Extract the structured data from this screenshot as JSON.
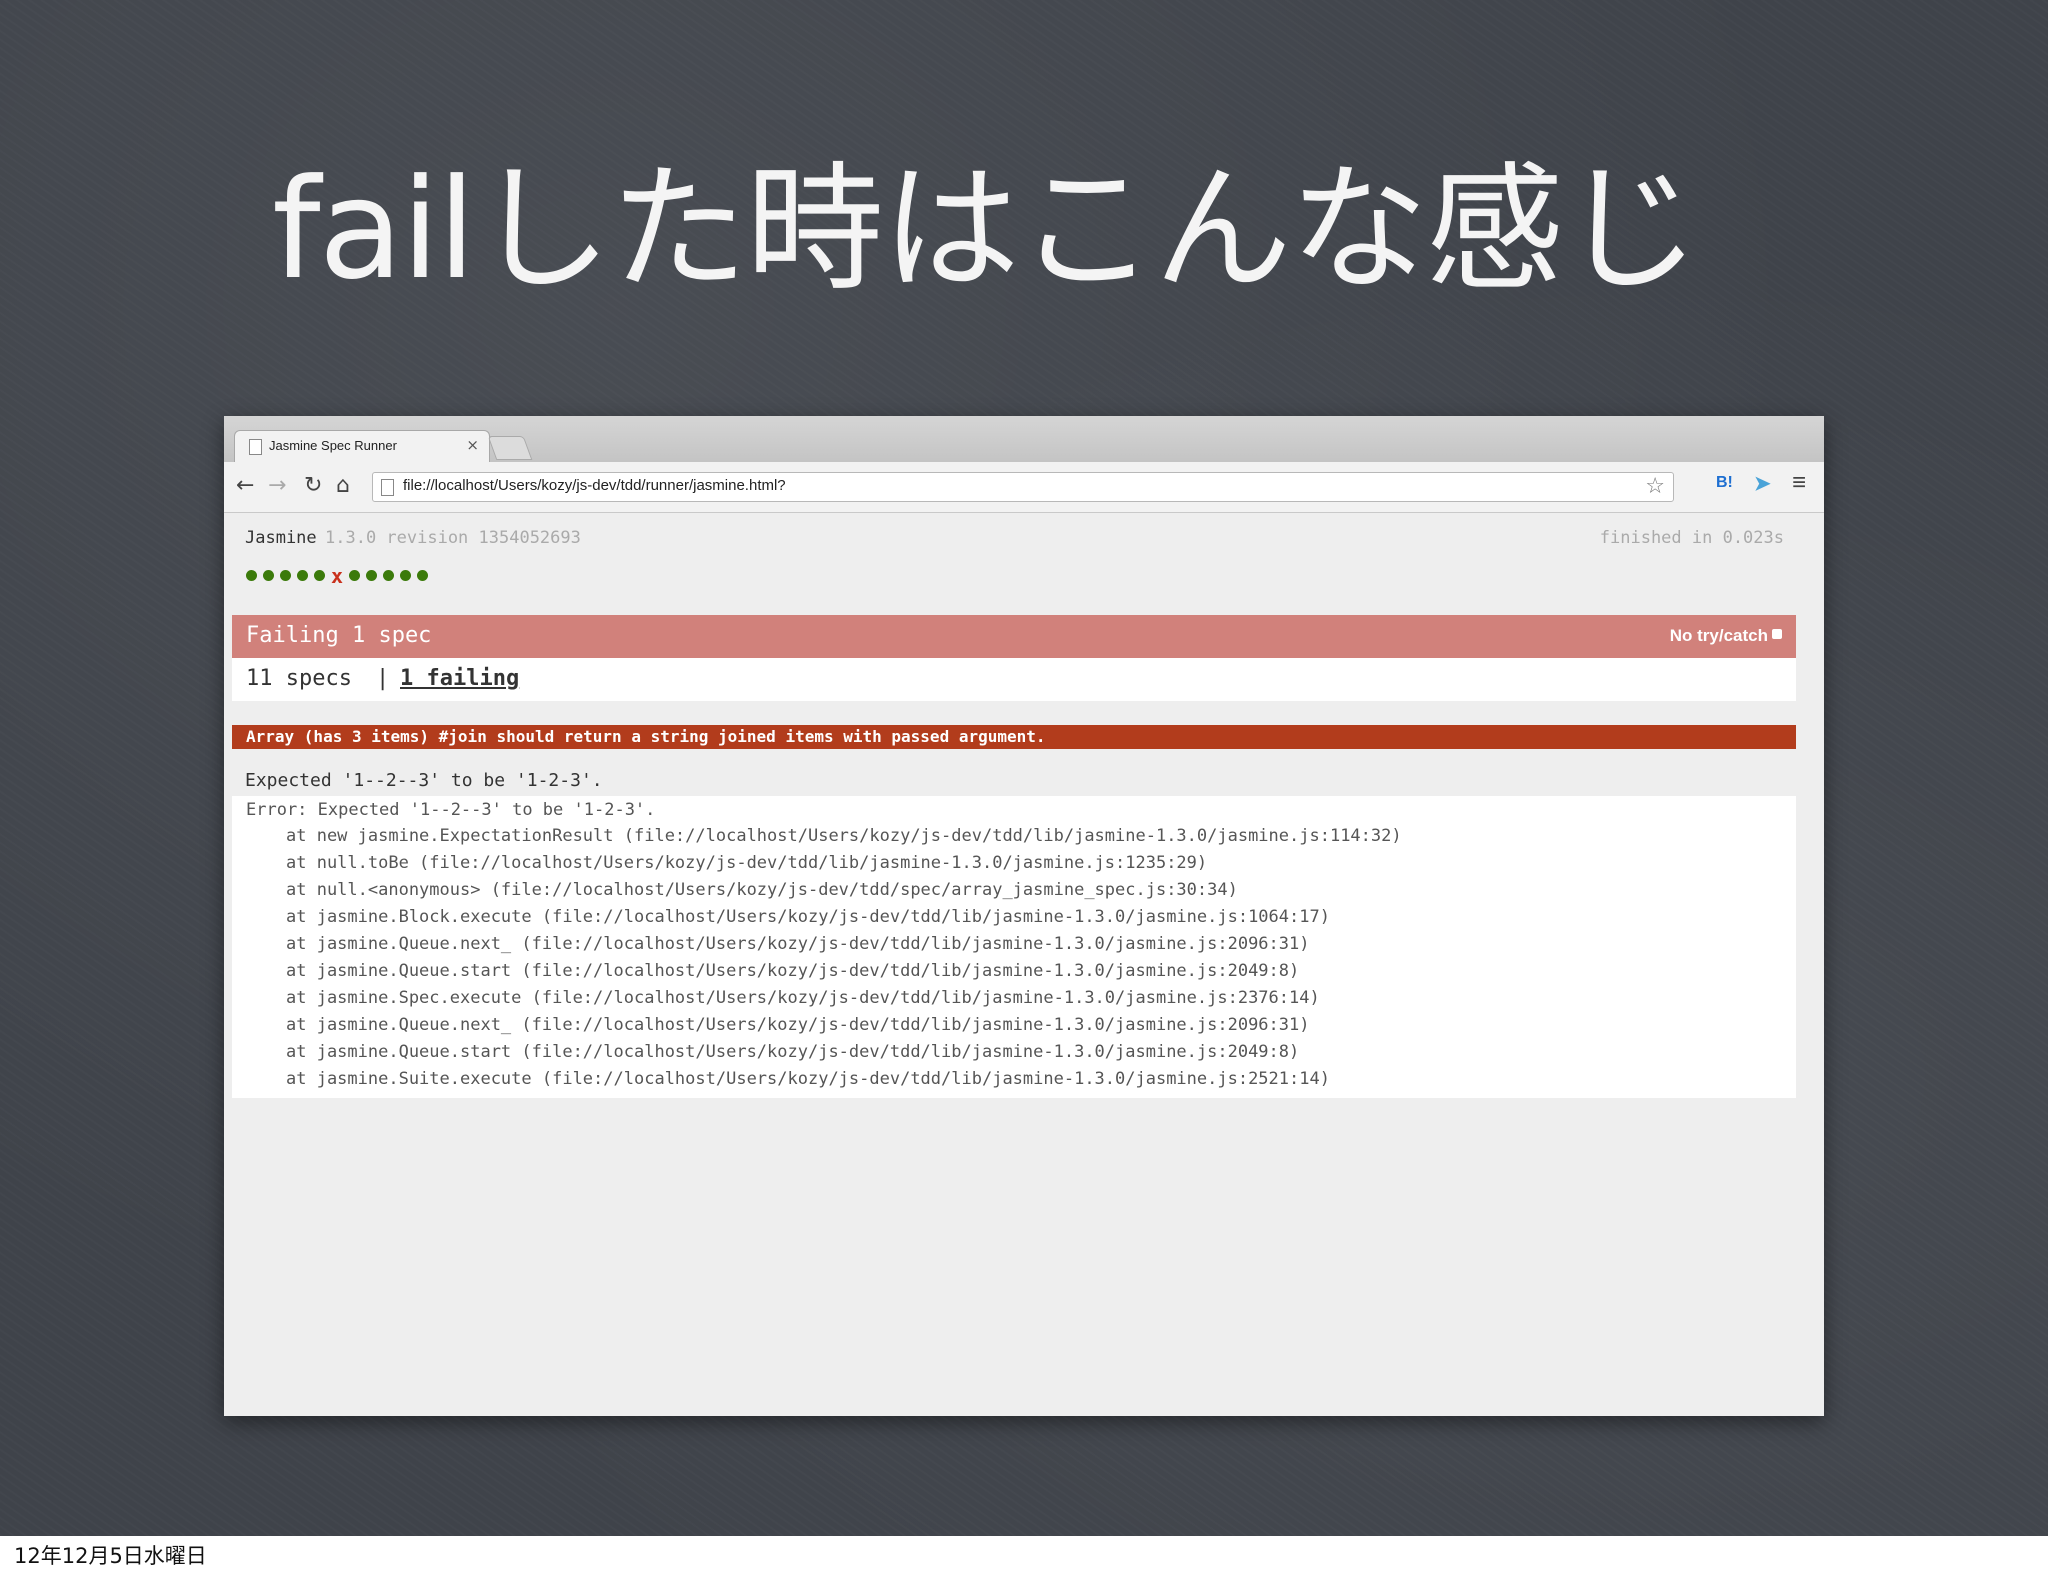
{
  "slide": {
    "title": "failした時はこんな感じ",
    "footer": "12年12月5日水曜日"
  },
  "browser": {
    "tab_title": "Jasmine Spec Runner",
    "tab_close": "×",
    "url": "file://localhost/Users/kozy/js-dev/tdd/runner/jasmine.html?",
    "ext_hatena": "B!",
    "menu_glyph": "≡"
  },
  "jasmine": {
    "name": "Jasmine",
    "version": "1.3.0 revision 1354052693",
    "duration": "finished in 0.023s",
    "symbols": [
      "passed",
      "passed",
      "passed",
      "passed",
      "passed",
      "failed",
      "passed",
      "passed",
      "passed",
      "passed",
      "passed"
    ],
    "fail_mark": "x",
    "fail_bar": "Failing 1 spec",
    "option": "No try/catch",
    "summary_specs": "11 specs",
    "summary_sep": "|",
    "summary_failing": "1 failing",
    "spec_description": "Array (has 3 items) #join should return a string joined items with passed argument.",
    "expected_message": "Expected '1--2--3' to be '1-2-3'.",
    "error_message": "Error: Expected '1--2--3' to be '1-2-3'.",
    "stack": [
      "at new jasmine.ExpectationResult (file://localhost/Users/kozy/js-dev/tdd/lib/jasmine-1.3.0/jasmine.js:114:32)",
      "at null.toBe (file://localhost/Users/kozy/js-dev/tdd/lib/jasmine-1.3.0/jasmine.js:1235:29)",
      "at null.<anonymous> (file://localhost/Users/kozy/js-dev/tdd/spec/array_jasmine_spec.js:30:34)",
      "at jasmine.Block.execute (file://localhost/Users/kozy/js-dev/tdd/lib/jasmine-1.3.0/jasmine.js:1064:17)",
      "at jasmine.Queue.next_ (file://localhost/Users/kozy/js-dev/tdd/lib/jasmine-1.3.0/jasmine.js:2096:31)",
      "at jasmine.Queue.start (file://localhost/Users/kozy/js-dev/tdd/lib/jasmine-1.3.0/jasmine.js:2049:8)",
      "at jasmine.Spec.execute (file://localhost/Users/kozy/js-dev/tdd/lib/jasmine-1.3.0/jasmine.js:2376:14)",
      "at jasmine.Queue.next_ (file://localhost/Users/kozy/js-dev/tdd/lib/jasmine-1.3.0/jasmine.js:2096:31)",
      "at jasmine.Queue.start (file://localhost/Users/kozy/js-dev/tdd/lib/jasmine-1.3.0/jasmine.js:2049:8)",
      "at jasmine.Suite.execute (file://localhost/Users/kozy/js-dev/tdd/lib/jasmine-1.3.0/jasmine.js:2521:14)"
    ]
  },
  "colors": {
    "failing_bar": "#d1817b",
    "spec_bar": "#b23c1c",
    "passed_dot": "#3b7a0a",
    "failed_mark": "#c9311d"
  }
}
